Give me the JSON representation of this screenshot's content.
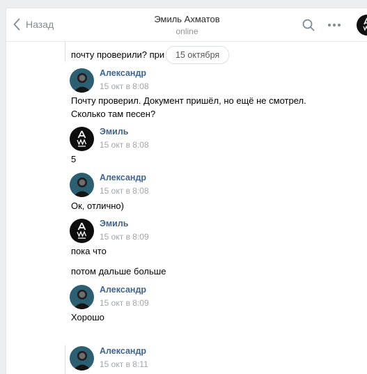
{
  "header": {
    "back_label": "Назад",
    "title": "Эмиль Ахматов",
    "status": "online"
  },
  "date_separator": "15 октября",
  "messages": [
    {
      "kind": "text",
      "text": "почту проверили? при"
    },
    {
      "kind": "author",
      "name": "Александр",
      "time": "15 окт в 8:08"
    },
    {
      "kind": "text",
      "text": "Почту проверил. Документ пришёл, но ещё не смотрел."
    },
    {
      "kind": "text",
      "text": "Сколько там песен?"
    },
    {
      "kind": "author",
      "name": "Эмиль",
      "time": "15 окт в 8:08"
    },
    {
      "kind": "text",
      "text": "5"
    },
    {
      "kind": "author",
      "name": "Александр",
      "time": "15 окт в 8:08"
    },
    {
      "kind": "text",
      "text": "Ок, отлично)"
    },
    {
      "kind": "author",
      "name": "Эмиль",
      "time": "15 окт в 8:09"
    },
    {
      "kind": "text",
      "text": "пока что"
    },
    {
      "kind": "text",
      "text": "потом дальше больше"
    },
    {
      "kind": "author",
      "name": "Александр",
      "time": "15 окт в 8:09"
    },
    {
      "kind": "text",
      "text": "Хорошо"
    },
    {
      "kind": "author",
      "name": "Александр",
      "time": "15 окт в 8:11"
    }
  ],
  "colors": {
    "link_blue": "#42648b",
    "muted": "#828a99",
    "background": "#edeef0"
  },
  "icons": [
    "chevron-left-icon",
    "search-icon",
    "more-icon"
  ]
}
